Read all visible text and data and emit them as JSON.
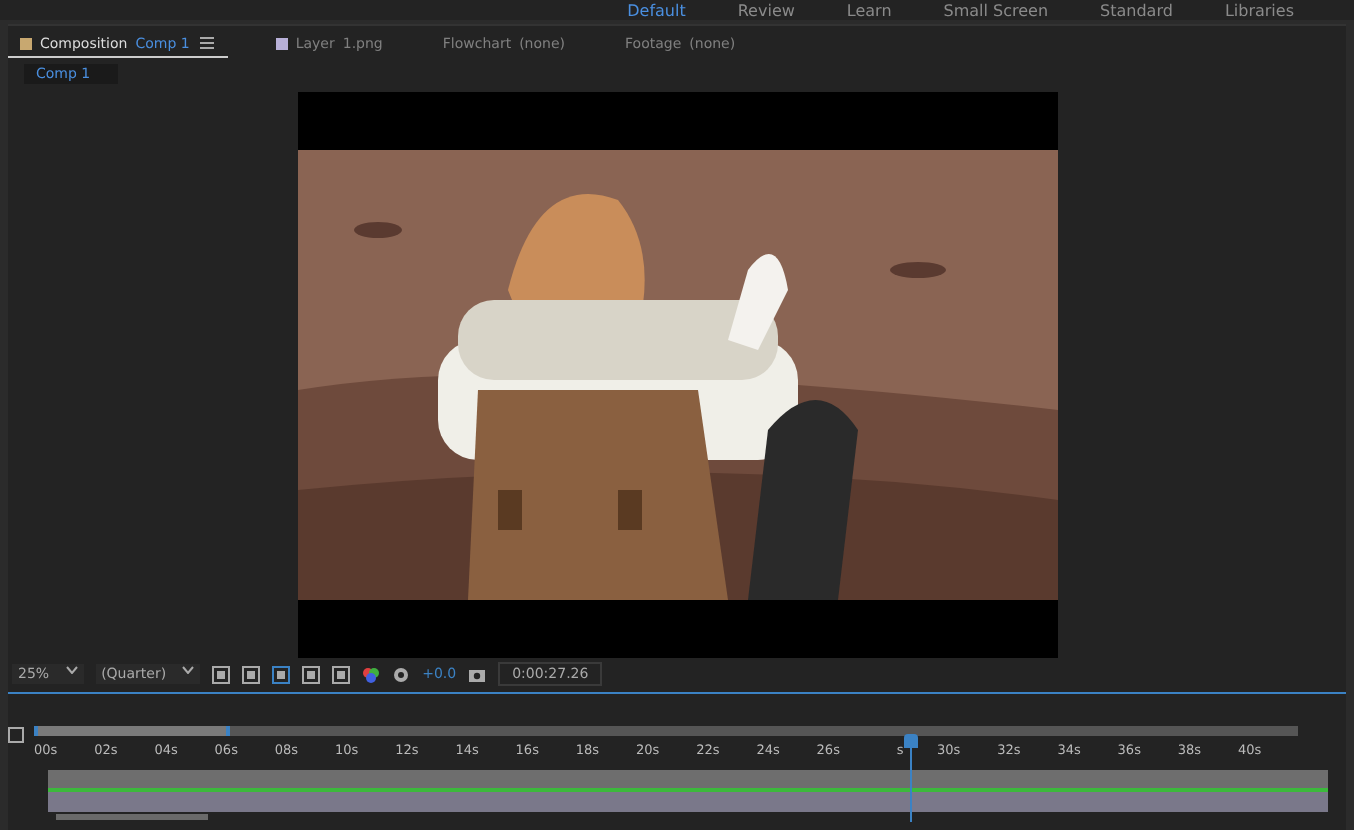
{
  "workspaces": [
    {
      "label": "Default",
      "selected": true
    },
    {
      "label": "Review",
      "selected": false
    },
    {
      "label": "Learn",
      "selected": false
    },
    {
      "label": "Small Screen",
      "selected": false
    },
    {
      "label": "Standard",
      "selected": false
    },
    {
      "label": "Libraries",
      "selected": false
    }
  ],
  "panel_tabs": [
    {
      "kind": "composition",
      "label": "Composition",
      "name": "Comp 1",
      "selected": true
    },
    {
      "kind": "layer",
      "label": "Layer",
      "name": "1.png",
      "selected": false
    },
    {
      "kind": "plain",
      "label": "Flowchart",
      "name": "(none)",
      "selected": false
    },
    {
      "kind": "plain",
      "label": "Footage",
      "name": "(none)",
      "selected": false
    }
  ],
  "viewer_tab": "Comp 1",
  "toolbar": {
    "zoom": "25%",
    "resolution": "(Quarter)",
    "exposure": "+0.0",
    "timecode": "0:00:27.26"
  },
  "timeline": {
    "ticks": [
      {
        "label": "00s",
        "kind": "full"
      },
      {
        "label": "02s",
        "kind": "full"
      },
      {
        "label": "04s",
        "kind": "full"
      },
      {
        "label": "06s",
        "kind": "full"
      },
      {
        "label": "08s",
        "kind": "full"
      },
      {
        "label": "10s",
        "kind": "full"
      },
      {
        "label": "12s",
        "kind": "full"
      },
      {
        "label": "14s",
        "kind": "full"
      },
      {
        "label": "16s",
        "kind": "full"
      },
      {
        "label": "18s",
        "kind": "full"
      },
      {
        "label": "20s",
        "kind": "full"
      },
      {
        "label": "22s",
        "kind": "full"
      },
      {
        "label": "24s",
        "kind": "full"
      },
      {
        "label": "26s",
        "kind": "full"
      },
      {
        "label": "s",
        "kind": "partial"
      },
      {
        "label": "30s",
        "kind": "full"
      },
      {
        "label": "32s",
        "kind": "full"
      },
      {
        "label": "34s",
        "kind": "full"
      },
      {
        "label": "36s",
        "kind": "full"
      },
      {
        "label": "38s",
        "kind": "full"
      },
      {
        "label": "40s",
        "kind": "full"
      }
    ],
    "playhead": {
      "level": 0.675
    },
    "work_area": {
      "level": 0.155
    }
  }
}
